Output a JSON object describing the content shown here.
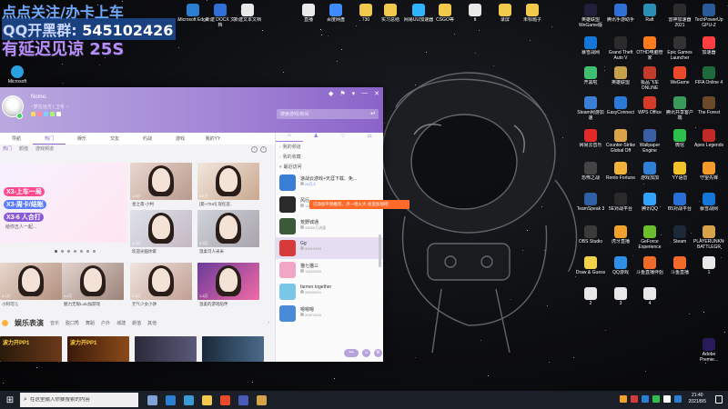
{
  "overlay": {
    "line1": "点点关注/办卡上车",
    "line2_prefix": "QQ开黑群:",
    "line2_number": "545102426",
    "line3": "有延迟见谅 25S"
  },
  "desktop_icons_top": [
    {
      "label": "Microsoft Edge",
      "color": "#2a7fd1"
    },
    {
      "label": "新建 DOCX 文档",
      "color": "#2f6fd6"
    },
    {
      "label": "新建文本文档",
      "color": "#e8e8e8"
    },
    {
      "label": "直播",
      "color": "#eaeaea"
    },
    {
      "label": "百度网盘",
      "color": "#3e8cff"
    },
    {
      "label": "730",
      "color": "#f2c94c"
    },
    {
      "label": "实习总结",
      "color": "#f2c94c"
    },
    {
      "label": "网易UU加速器",
      "color": "#2fb3ff"
    },
    {
      "label": "CSGO等",
      "color": "#f2c94c"
    },
    {
      "label": "tt",
      "color": "#e8e8e8"
    },
    {
      "label": "录屏",
      "color": "#f2c94c"
    },
    {
      "label": "未标题子",
      "color": "#f2c94c"
    }
  ],
  "desktop_left_icon": {
    "label": "Microsoft",
    "color": "#2ba0e0"
  },
  "desktop_icons_right": [
    {
      "label": "英雄联盟WeGame版",
      "color": "#1f1f3a"
    },
    {
      "label": "腾讯手游助手",
      "color": "#2f6fd6"
    },
    {
      "label": "Raft",
      "color": "#2b8fb5"
    },
    {
      "label": "雷神加速器2021",
      "color": "#2b2b2b"
    },
    {
      "label": "TechPowerUp GPU-Z",
      "color": "#2a5a9a"
    },
    {
      "label": "暴雪战网",
      "color": "#1477d8"
    },
    {
      "label": "Grand Theft Auto V",
      "color": "#2b2b2b"
    },
    {
      "label": "OTHD电脑管家",
      "color": "#ff7a1a"
    },
    {
      "label": "Epic Games Launcher",
      "color": "#333"
    },
    {
      "label": "加速器",
      "color": "#ff3f3f"
    },
    {
      "label": "开黑啦",
      "color": "#3fbf6f"
    },
    {
      "label": "英雄联盟",
      "color": "#c8a24a"
    },
    {
      "label": "极品飞车 ONLINE",
      "color": "#c23a2a"
    },
    {
      "label": "WeGame",
      "color": "#e84a2a"
    },
    {
      "label": "FIFA Online 4",
      "color": "#1d6a3a"
    },
    {
      "label": "Steam网游加速",
      "color": "#3a7fd5"
    },
    {
      "label": "EasyConnect",
      "color": "#2c7ad8"
    },
    {
      "label": "WPS Office",
      "color": "#d63a2a"
    },
    {
      "label": "腾讯共享客户端",
      "color": "#3a9a5a"
    },
    {
      "label": "The Forest",
      "color": "#6a4a2a"
    },
    {
      "label": "网易云音乐",
      "color": "#e12a2a"
    },
    {
      "label": "Counter-Strike Global Off",
      "color": "#dca24a"
    },
    {
      "label": "Wallpaper Engine",
      "color": "#3a5fa5"
    },
    {
      "label": "微信",
      "color": "#2fbf4f"
    },
    {
      "label": "Apex Legends",
      "color": "#c22a2a"
    },
    {
      "label": "恐怖之战",
      "color": "#444"
    },
    {
      "label": "Rento Fortune",
      "color": "#f2b23a"
    },
    {
      "label": "游戏加加",
      "color": "#2f7fd6"
    },
    {
      "label": "YY语音",
      "color": "#f2c22a"
    },
    {
      "label": "守望先锋",
      "color": "#f29a2a"
    },
    {
      "label": "TeamSpeak 3",
      "color": "#2f5fa5"
    },
    {
      "label": "5E对战平台",
      "color": "#2a2a2a"
    },
    {
      "label": "腾讯QQ",
      "color": "#2fa3ff"
    },
    {
      "label": "B5对战平台",
      "color": "#2a6fd6"
    },
    {
      "label": "暴雪战网",
      "color": "#1477d8"
    },
    {
      "label": "OBS Studio",
      "color": "#3a3a3a"
    },
    {
      "label": "虎牙直播",
      "color": "#f2a22a"
    },
    {
      "label": "GeForce Experience",
      "color": "#6abf2a"
    },
    {
      "label": "Steam",
      "color": "#1b2838"
    },
    {
      "label": "PLAYERUNKNOWN'S BATTLEGR",
      "color": "#d6a24a"
    },
    {
      "label": "Draw & Guess",
      "color": "#f2d24a"
    },
    {
      "label": "QQ游戏",
      "color": "#2f8fe6"
    },
    {
      "label": "斗鱼直播伴侣",
      "color": "#f26a2a"
    },
    {
      "label": "斗鱼直播",
      "color": "#f26a2a"
    },
    {
      "label": "1",
      "color": "#e8e8e8"
    },
    {
      "label": "2",
      "color": "#e8e8e8"
    },
    {
      "label": "3",
      "color": "#e8e8e8"
    },
    {
      "label": "4",
      "color": "#e8e8e8"
    },
    {
      "label": "Adobe Premie...",
      "color": "#2a1a5a"
    }
  ],
  "app": {
    "user": {
      "nickname": "Nomo.",
      "signature": "~梦在远方 | 卫冬 ~"
    },
    "window_controls": [
      "◆",
      "⚑",
      "▾",
      "—",
      "✕"
    ],
    "search": {
      "placeholder": "搜索游戏/房间",
      "go": "↵"
    },
    "nav_tabs": [
      {
        "label": "导航",
        "active": false
      },
      {
        "label": "热门",
        "active": true
      },
      {
        "label": "娱乐",
        "active": false
      },
      {
        "label": "交友",
        "active": false
      },
      {
        "label": "约战",
        "active": false
      },
      {
        "label": "游戏",
        "active": false
      },
      {
        "label": "我的YY",
        "active": false
      }
    ],
    "sub_tabs": [
      {
        "label": "热门",
        "active": true
      },
      {
        "label": "颜值",
        "active": false
      },
      {
        "label": "游戏频道",
        "active": false
      }
    ],
    "promo_pills": [
      "X3-上车一局",
      "X3-周卡/结账",
      "X3-6 人合打"
    ],
    "promo_sub": "给你五人一起...",
    "tiles": [
      {
        "caption": "星之夜-小柯",
        "count": "1.5万"
      },
      {
        "caption": "[第+70㎡] 现任首..",
        "count": "5.1万"
      },
      {
        "caption": "欢迎光临你家",
        "count": "4.2万"
      },
      {
        "caption": "温柔可人米米",
        "count": "3.3万"
      },
      {
        "caption": "小阿可儿",
        "count": "1.1万"
      },
      {
        "caption": "魅力无限Lulu加游戏",
        "count": "1.4万"
      },
      {
        "caption": "元气少女小饼",
        "count": "2.8万"
      },
      {
        "caption": "温柔的游戏陪伴",
        "count": "1.6万"
      }
    ],
    "page_ctrls": [
      "‹",
      "›"
    ],
    "section": {
      "title": "娱乐表演",
      "tabs": [
        "音乐",
        "脱口秀",
        "舞蹈",
        "户外",
        "城建",
        "颜值",
        "其他"
      ],
      "more": "›"
    },
    "bottom_tiles": [
      "波力开PP1",
      "波力开PP1",
      "",
      ""
    ],
    "right_panel": {
      "tabs": [
        "⌂",
        "♟",
        "♡",
        "⚏"
      ],
      "sections": [
        {
          "label": "我的频道",
          "open": false
        },
        {
          "label": "我的收藏",
          "open": false
        },
        {
          "label": "最近访问",
          "open": true
        }
      ],
      "games": [
        {
          "name": "速战云游戏+天涯下载、免...",
          "count": "24万人",
          "blue": true,
          "color": "#3a7fd6"
        },
        {
          "name": "风行",
          "count": "13050万流量",
          "blue": false,
          "color": "#2a2a2a"
        },
        {
          "name": "荒野城通",
          "count": "33000万流量",
          "blue": false,
          "color": "#3a5a3a"
        },
        {
          "name": "Gg",
          "count": "40019433",
          "blue": false,
          "color": "#d63a3a"
        },
        {
          "name": "猫七猫三",
          "count": "14523150",
          "blue": false,
          "color": "#f2a6c6"
        },
        {
          "name": "farmer together",
          "count": "28000000",
          "blue": false,
          "color": "#7ac6e6"
        },
        {
          "name": "嗯嗯嗯",
          "count": "20971003",
          "blue": false,
          "color": "#4a8ad6"
        }
      ],
      "tooltip": "已添加平频推荐。点一哈火大·会里加加吧",
      "footer": [
        "•••",
        "☺",
        "⚙"
      ]
    }
  },
  "taskbar": {
    "start": "⊞",
    "search_placeholder": "在这里输入你要搜索的内容",
    "search_glyph": "⌕",
    "apps": [
      "#7fa3d6",
      "#2a7fd1",
      "#3a9ad6",
      "#f2c94c",
      "#e84a2a",
      "#4a5ab8",
      "#d6a24a"
    ],
    "tray_icons": [
      "#f2a22a",
      "#d63a3a",
      "#2a7fd1",
      "#2fbf4f",
      "#ffffff",
      "#2a7fd1"
    ],
    "time": "21:40",
    "date": "2021/8/5"
  }
}
